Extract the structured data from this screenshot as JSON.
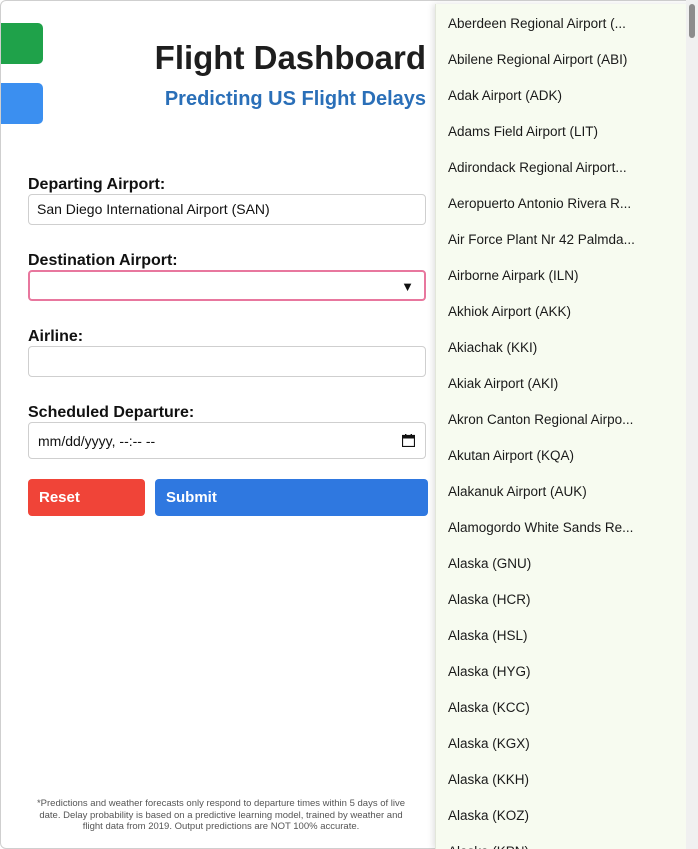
{
  "header": {
    "title": "Flight Dashboard",
    "subtitle": "Predicting US Flight Delays"
  },
  "form": {
    "departing_label": "Departing Airport:",
    "departing_value": "San Diego International Airport (SAN)",
    "destination_label": "Destination Airport:",
    "destination_value": "",
    "airline_label": "Airline:",
    "airline_value": "",
    "departure_label": "Scheduled Departure:",
    "departure_value": "mm/dd/yyyy, --:-- --",
    "reset_label": "Reset",
    "submit_label": "Submit"
  },
  "footer": {
    "note": "*Predictions and weather forecasts only respond to departure times within 5 days of live date. Delay probability is based on a predictive learning model, trained by weather and flight data from 2019. Output predictions are NOT 100% accurate."
  },
  "dropdown": {
    "options": [
      "Aberdeen Regional Airport (...",
      "Abilene Regional Airport (ABI)",
      "Adak Airport (ADK)",
      "Adams Field Airport (LIT)",
      "Adirondack Regional Airport...",
      "Aeropuerto Antonio Rivera R...",
      "Air Force Plant Nr 42 Palmda...",
      "Airborne Airpark (ILN)",
      "Akhiok Airport (AKK)",
      "Akiachak (KKI)",
      "Akiak Airport (AKI)",
      "Akron Canton Regional Airpo...",
      "Akutan Airport (KQA)",
      "Alakanuk Airport (AUK)",
      "Alamogordo White Sands Re...",
      "Alaska (GNU)",
      "Alaska (HCR)",
      "Alaska (HSL)",
      "Alaska (HYG)",
      "Alaska (KCC)",
      "Alaska (KGX)",
      "Alaska (KKH)",
      "Alaska (KOZ)",
      "Alaska (KPN)"
    ]
  },
  "colors": {
    "reset": "#f04438",
    "submit": "#2f78e0",
    "focus_border": "#e8779e",
    "subtitle": "#2a6fb8",
    "dropdown_bg": "#f7fbf0"
  }
}
